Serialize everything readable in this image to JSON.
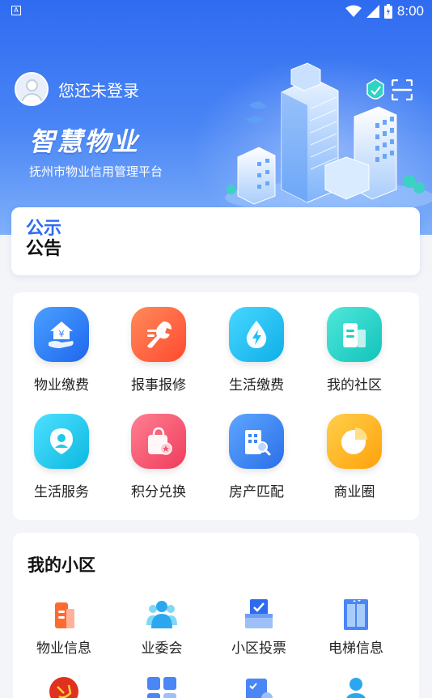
{
  "header": {
    "login_text": "您还未登录",
    "brand_title": "智慧物业",
    "brand_subtitle": "抚州市物业信用管理平台"
  },
  "status_bar": {
    "time": "8:00",
    "indicator": "A"
  },
  "notice": {
    "label_line1": "公示",
    "label_line2": "公告"
  },
  "services": [
    {
      "label": "物业缴费",
      "icon": "property-fee-icon",
      "color": "#2f7df5"
    },
    {
      "label": "报事报修",
      "icon": "repair-wrench-icon",
      "color": "#ff5a3c"
    },
    {
      "label": "生活缴费",
      "icon": "water-drop-icon",
      "color": "#1ec0f0"
    },
    {
      "label": "我的社区",
      "icon": "community-building-icon",
      "color": "#1fd0c6"
    },
    {
      "label": "生活服务",
      "icon": "life-service-icon",
      "color": "#1fc9e8"
    },
    {
      "label": "积分兑换",
      "icon": "points-bag-icon",
      "color": "#f3566f"
    },
    {
      "label": "房产匹配",
      "icon": "estate-search-icon",
      "color": "#3a86f5"
    },
    {
      "label": "商业圈",
      "icon": "pie-chart-icon",
      "color": "#ffb21c"
    }
  ],
  "community": {
    "title": "我的小区",
    "items": [
      {
        "label": "物业信息",
        "icon": "property-info-icon"
      },
      {
        "label": "业委会",
        "icon": "committee-people-icon"
      },
      {
        "label": "小区投票",
        "icon": "vote-box-icon"
      },
      {
        "label": "电梯信息",
        "icon": "elevator-icon"
      }
    ]
  }
}
